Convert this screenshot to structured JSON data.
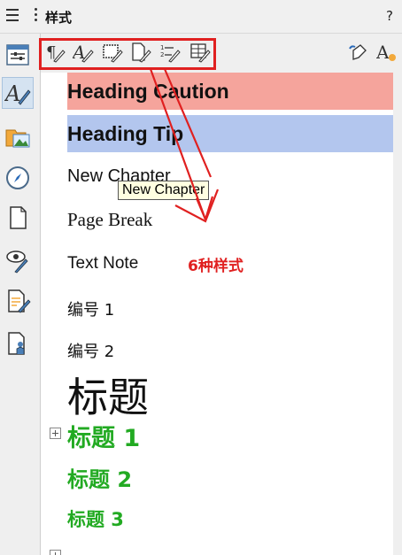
{
  "panel": {
    "title": "样式",
    "help_label": "?"
  },
  "sidebar": {
    "items": [
      {
        "name": "properties-icon"
      },
      {
        "name": "styles-icon",
        "active": true
      },
      {
        "name": "gallery-icon"
      },
      {
        "name": "navigator-icon"
      },
      {
        "name": "page-icon"
      },
      {
        "name": "style-inspector-icon"
      },
      {
        "name": "manage-changes-icon"
      },
      {
        "name": "design-icon"
      }
    ]
  },
  "toolbar": {
    "style_category_buttons": [
      {
        "name": "paragraph-styles-icon"
      },
      {
        "name": "character-styles-icon"
      },
      {
        "name": "frame-styles-icon"
      },
      {
        "name": "page-styles-icon"
      },
      {
        "name": "list-styles-icon"
      },
      {
        "name": "table-styles-icon"
      }
    ],
    "fill-format-icon": "fill-format-mode-icon",
    "new-style-icon": "new-style-actions-icon"
  },
  "styles": {
    "items": [
      {
        "label": "Heading Caution"
      },
      {
        "label": "Heading Tip"
      },
      {
        "label": "New Chapter"
      },
      {
        "label": "Page Break"
      },
      {
        "label": "Text Note"
      },
      {
        "label": "编号 1"
      },
      {
        "label": "编号 2"
      },
      {
        "label": "标题"
      },
      {
        "label": "标题 1"
      },
      {
        "label": "标题 2"
      },
      {
        "label": "标题 3"
      }
    ]
  },
  "tooltip": {
    "text": "New Chapter"
  },
  "annotation": {
    "text": "6种样式"
  },
  "colors": {
    "caution_band": "#f5a49c",
    "tip_band": "#b3c6ee",
    "heading_green": "#22aa22",
    "annotation_red": "#e02020",
    "tooltip_bg": "#ffffe1"
  }
}
